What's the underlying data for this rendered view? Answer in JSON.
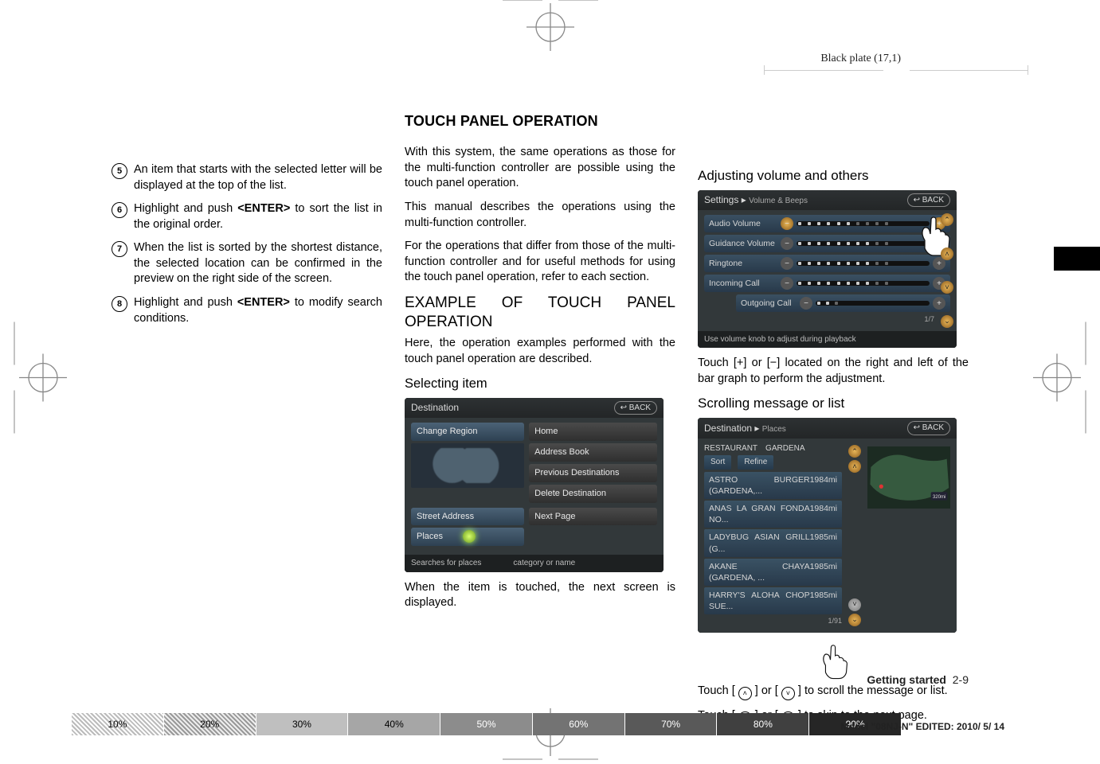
{
  "meta": {
    "plate": "Black plate (17,1)",
    "footer_page": "Getting started",
    "footer_page_num": "2-9",
    "model_line": "Model \"08NJ-N\"   EDITED:  2010/ 5/ 14",
    "gradient_labels": [
      "10%",
      "20%",
      "30%",
      "40%",
      "50%",
      "60%",
      "70%",
      "80%",
      "90%"
    ]
  },
  "left_column": {
    "items": [
      {
        "n": "5",
        "text": "An item that starts with the selected letter will be displayed at the top of the list."
      },
      {
        "n": "6",
        "text_before": "Highlight and push ",
        "bold": "<ENTER>",
        "text_after": " to sort the list in the original order."
      },
      {
        "n": "7",
        "text": "When the list is sorted by the shortest distance, the selected location can be confirmed in the preview on the right side of the screen."
      },
      {
        "n": "8",
        "text_before": "Highlight and push ",
        "bold": "<ENTER>",
        "text_after": " to modify search conditions."
      }
    ]
  },
  "center_column": {
    "title": "TOUCH PANEL OPERATION",
    "p1": "With this system, the same operations as those for the multi-function controller are possible using the touch panel operation.",
    "p2": "This manual describes the operations using the multi-function controller.",
    "p3": "For the operations that differ from those of the multi-function controller and for useful methods for using the touch panel operation, refer to each section.",
    "sub1": "EXAMPLE OF TOUCH PANEL OPERATION",
    "p4": "Here, the operation examples performed with the touch panel operation are described.",
    "mini1": "Selecting item",
    "p5": "When the item is touched, the next screen is displayed.",
    "dest_screen": {
      "header": "Destination",
      "back": "BACK",
      "left_buttons": [
        "Change Region",
        "Street Address",
        "Places"
      ],
      "right_buttons": [
        "Home",
        "Address Book",
        "Previous Destinations",
        "Delete Destination",
        "Next Page"
      ],
      "hint_left": "Searches for places",
      "hint_right": "category or name"
    }
  },
  "right_column": {
    "head1": "Adjusting volume and others",
    "settings_screen": {
      "header": "Settings",
      "crumb": "Volume & Beeps",
      "back": "BACK",
      "rows": [
        "Audio Volume",
        "Guidance Volume",
        "Ringtone",
        "Incoming Call",
        "Outgoing Call"
      ],
      "page": "1/7",
      "hint": "Use volume knob to adjust during playback"
    },
    "p1": "Touch [+] or [−] located on the right and left of the bar graph to perform the adjustment.",
    "head2": "Scrolling message or list",
    "places_screen": {
      "header": "Destination",
      "crumb": "Places",
      "back": "BACK",
      "filter_a": "RESTAURANT",
      "filter_b": "GARDENA",
      "sort": "Sort",
      "refine": "Refine",
      "items": [
        {
          "name": "ASTRO BURGER (GARDENA,...",
          "dist": "1984mi"
        },
        {
          "name": "ANAS LA GRAN FONDA NO...",
          "dist": "1984mi"
        },
        {
          "name": "LADYBUG ASIAN GRILL (G...",
          "dist": "1985mi"
        },
        {
          "name": "AKANE CHAYA (GARDENA, ...",
          "dist": "1985mi"
        },
        {
          "name": "HARRY'S ALOHA CHOP SUE...",
          "dist": "1985mi"
        }
      ],
      "page": "1/91",
      "map_label": "320mi"
    },
    "p2a": "Touch [ ",
    "p2b": " ] or [ ",
    "p2c": " ] to scroll the message or list.",
    "p3a": "Touch [ ",
    "p3b": " ] or [ ",
    "p3c": " ] to skip to the next page."
  }
}
